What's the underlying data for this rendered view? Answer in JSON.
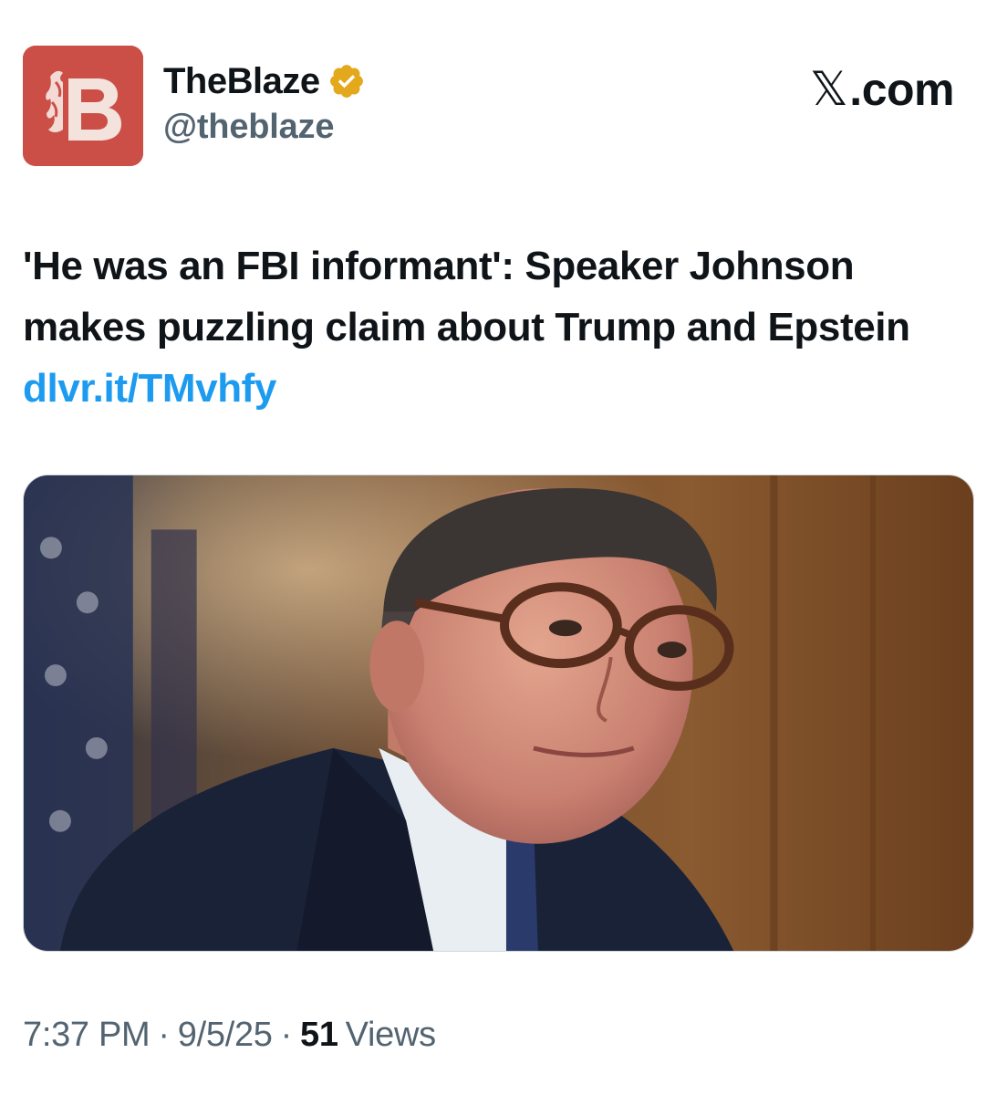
{
  "account": {
    "display_name": "TheBlaze",
    "handle": "@theblaze",
    "verified": true,
    "avatar_icon": "theblaze-flame-b-logo",
    "avatar_color": "#cc4f47",
    "verified_color": "#e3a81b"
  },
  "brand": {
    "x_glyph": "𝕏",
    "label": ".com"
  },
  "tweet": {
    "text": "'He was an FBI informant': Speaker Johnson makes puzzling claim about Trump and Epstein",
    "link": "dlvr.it/TMvhfy",
    "link_color": "#1d9bf0"
  },
  "media": {
    "icon": "photo-speaker-johnson"
  },
  "meta": {
    "time": "7:37 PM",
    "separator": "·",
    "date": "9/5/25",
    "views_count": "51",
    "views_label": "Views"
  }
}
